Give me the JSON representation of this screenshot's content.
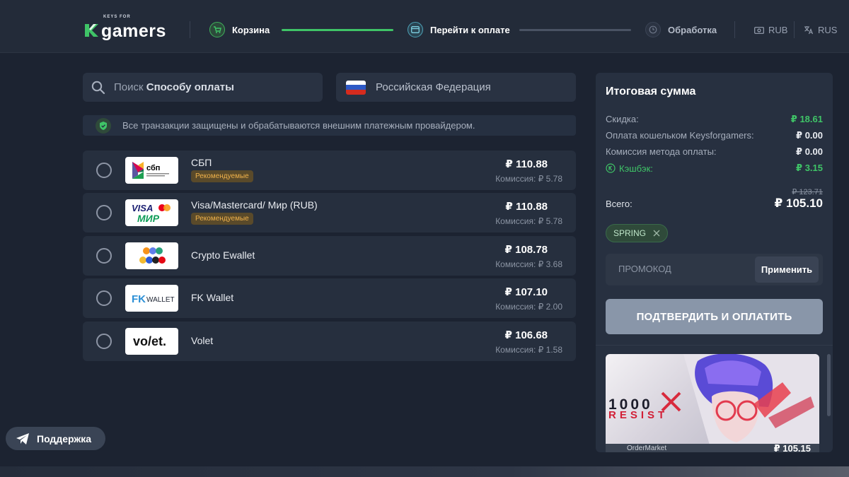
{
  "header": {
    "logo_small": "KEYS FOR",
    "logo_text": "gamers",
    "steps": [
      {
        "label": "Корзина"
      },
      {
        "label": "Перейти к оплате"
      },
      {
        "label": "Обработка"
      }
    ],
    "currency": "RUB",
    "language": "RUS"
  },
  "search": {
    "prefix": "Поиск",
    "bold": "Способу оплаты"
  },
  "country": "Российская Федерация",
  "notice": "Все транзакции защищены и обрабатываются внешним платежным провайдером.",
  "payment_methods": [
    {
      "name": "СБП",
      "badge": "Рекомендуемые",
      "price": "₽ 110.88",
      "fee": "Комиссия: ₽ 5.78",
      "logo": "sbp-logo"
    },
    {
      "name": "Visa/Mastercard/ Мир (RUB)",
      "badge": "Рекомендуемые",
      "price": "₽ 110.88",
      "fee": "Комиссия: ₽ 5.78",
      "logo": "visa-mir-logo"
    },
    {
      "name": "Crypto Ewallet",
      "badge": "",
      "price": "₽ 108.78",
      "fee": "Комиссия: ₽ 3.68",
      "logo": "crypto-logo"
    },
    {
      "name": "FK Wallet",
      "badge": "",
      "price": "₽ 107.10",
      "fee": "Комиссия: ₽ 2.00",
      "logo": "fk-wallet-logo"
    },
    {
      "name": "Volet",
      "badge": "",
      "price": "₽ 106.68",
      "fee": "Комиссия: ₽ 1.58",
      "logo": "volet-logo"
    }
  ],
  "summary": {
    "title": "Итоговая сумма",
    "lines": [
      {
        "label": "Скидка:",
        "value": "₽ 18.61"
      },
      {
        "label": "Оплата кошельком Keysforgamers:",
        "value": "₽ 0.00"
      },
      {
        "label": "Комиссия метода оплаты:",
        "value": "₽ 0.00"
      },
      {
        "label": "Кэшбэк:",
        "value": "₽ 3.15"
      }
    ],
    "old_total": "₽ 123.71",
    "total_label": "Всего:",
    "total": "₽ 105.10",
    "promo_tag": "SPRING",
    "promo_placeholder": "ПРОМОКОД",
    "apply_label": "Применить",
    "confirm_label": "ПОДТВЕРДИТЬ И ОПЛАТИТЬ"
  },
  "game": {
    "title_line1": "1000",
    "title_line2": "RESIST",
    "seller": "OrderMarket",
    "price": "₽ 105.15"
  },
  "support_label": "Поддержка",
  "colors": {
    "accent_green": "#3fc467",
    "badge_orange": "#f0b24b",
    "confirm_button": "#8996a9"
  }
}
